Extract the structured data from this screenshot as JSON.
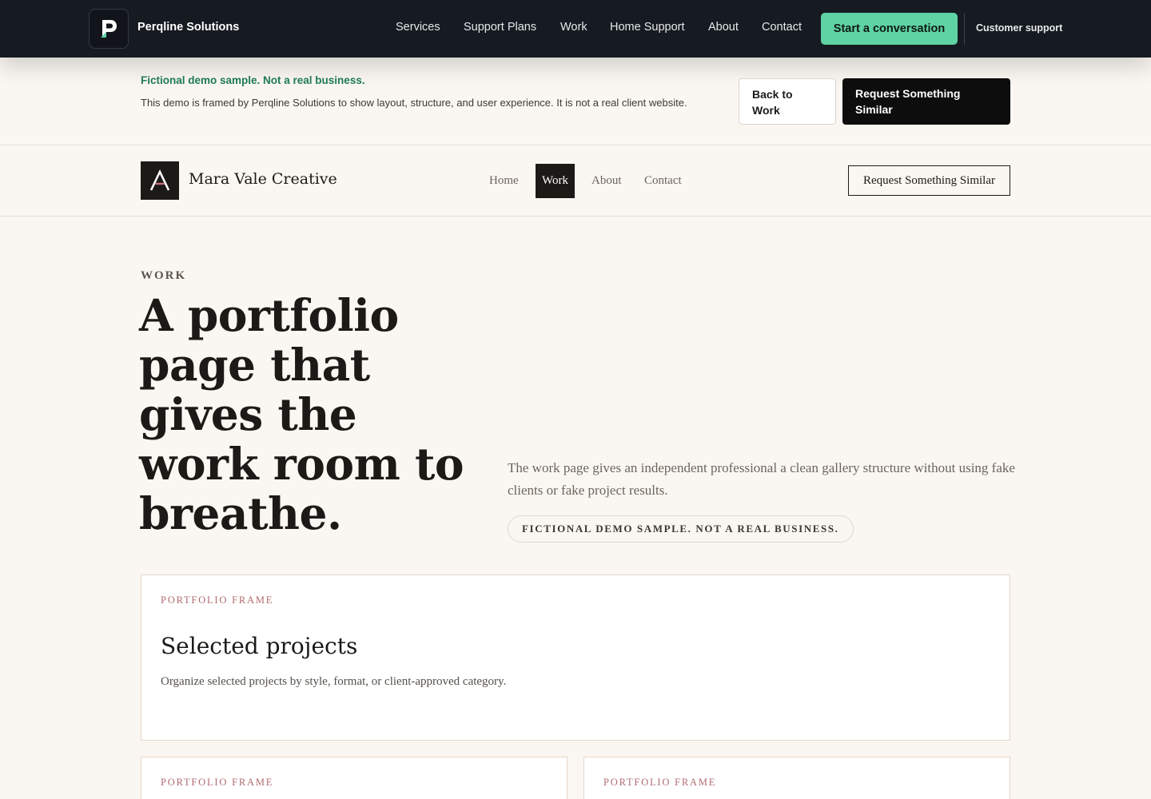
{
  "agency": {
    "brand": "Perqline Solutions",
    "nav": [
      "Services",
      "Support Plans",
      "Work",
      "Home Support",
      "About",
      "Contact"
    ],
    "cta": "Start a conversation",
    "support": "Customer support"
  },
  "notice": {
    "title": "Fictional demo sample. Not a real business.",
    "body": "This demo is framed by Perqline Solutions to show layout, structure, and user experience. It is not a real client website.",
    "back_button": "Back to Work",
    "request_button": "Request Something Similar"
  },
  "site": {
    "name": "Mara Vale Creative",
    "nav": [
      "Home",
      "Work",
      "About",
      "Contact"
    ],
    "active_nav": "Work",
    "request_button": "Request Something Similar"
  },
  "hero": {
    "eyebrow": "WORK",
    "title": "A portfolio page that gives the work room to breathe.",
    "description": "The work page gives an independent professional a clean gallery structure without using fake clients or fake project results.",
    "pill": "FICTIONAL DEMO SAMPLE. NOT A REAL BUSINESS."
  },
  "cards": [
    {
      "eyebrow": "PORTFOLIO FRAME",
      "title": "Selected projects",
      "description": "Organize selected projects by style, format, or client-approved category."
    },
    {
      "eyebrow": "PORTFOLIO FRAME"
    },
    {
      "eyebrow": "PORTFOLIO FRAME"
    }
  ],
  "colors": {
    "topbar": "#161b22",
    "accent_green": "#5fd3a3",
    "notice_green": "#1e7a52",
    "page_bg": "#faf7f2",
    "card_eyebrow": "#b06a70"
  }
}
